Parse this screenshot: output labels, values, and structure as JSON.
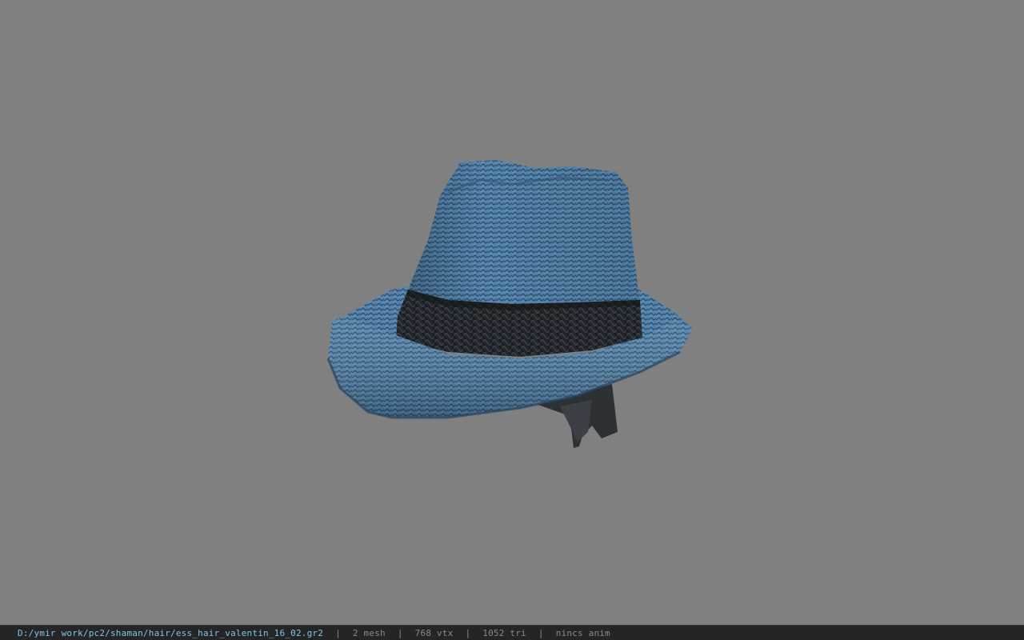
{
  "viewer": {
    "background_color": "#808080",
    "model": {
      "description_icon": "hat-model",
      "hat_color": "#4f7fa5",
      "band_color": "#1c1f22"
    }
  },
  "status_bar": {
    "file_path": "D:/ymir work/pc2/shaman/hair/ess_hair_valentin_16_02.gr2",
    "separator": "|",
    "mesh_count": "2 mesh",
    "vertex_count": "768 vtx",
    "triangle_count": "1052 tri",
    "anim_status": "nincs anim"
  }
}
